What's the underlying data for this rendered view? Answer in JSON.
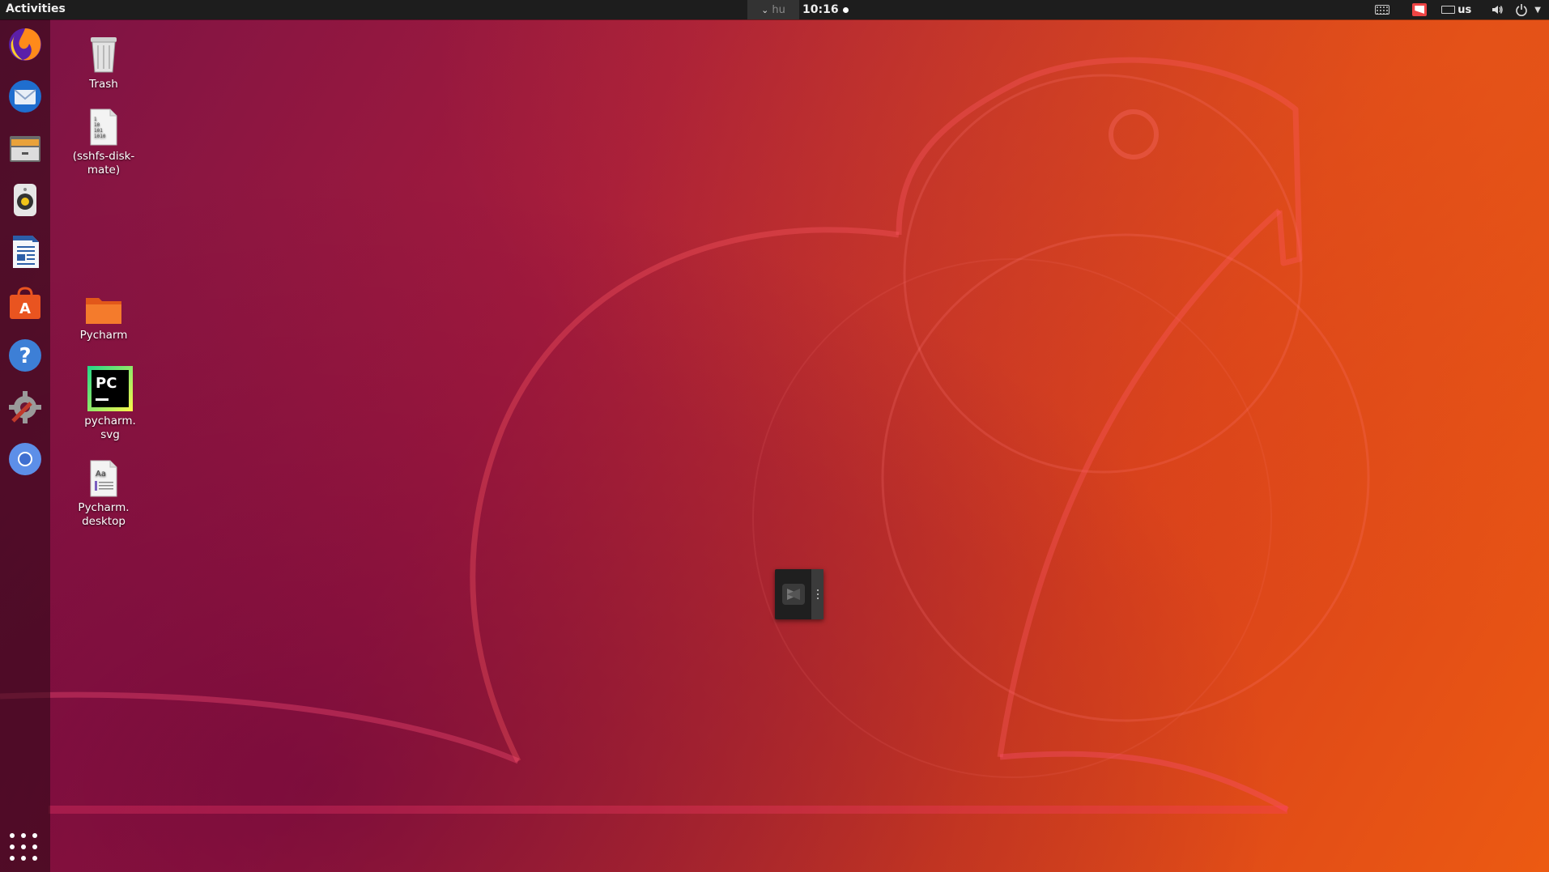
{
  "topbar": {
    "activities_label": "Activities",
    "input_source_label": "hu",
    "clock_text": "10:16",
    "language_label": "us",
    "icons": [
      "chevron-down-icon",
      "keyboard-icon",
      "screenshot-flag-icon",
      "keyboard-layout-icon",
      "volume-icon",
      "power-icon",
      "menu-arrow-icon"
    ]
  },
  "dock": {
    "items": [
      {
        "name": "firefox",
        "icon": "firefox-icon"
      },
      {
        "name": "thunderbird",
        "icon": "thunderbird-icon"
      },
      {
        "name": "files",
        "icon": "files-icon"
      },
      {
        "name": "rhythmbox",
        "icon": "rhythmbox-icon"
      },
      {
        "name": "libreoffice-writer",
        "icon": "writer-icon"
      },
      {
        "name": "software-center",
        "icon": "software-icon"
      },
      {
        "name": "help",
        "icon": "help-icon"
      },
      {
        "name": "settings",
        "icon": "settings-icon"
      },
      {
        "name": "chromium",
        "icon": "chromium-icon"
      }
    ],
    "show_apps_icon": "apps-grid-icon"
  },
  "desktop": {
    "icons": [
      {
        "label": "Trash",
        "icon": "trash-icon"
      },
      {
        "label": "(sshfs-disk-mate)",
        "icon": "binary-file-icon"
      },
      {
        "label": "Pycharm",
        "icon": "folder-icon"
      },
      {
        "label": "pycharm.svg",
        "icon": "pycharm-icon"
      },
      {
        "label": "Pycharm.desktop",
        "icon": "font-file-icon"
      }
    ]
  },
  "colors": {
    "topbar_bg": "#1d1d1d",
    "wall_orange": "#ec5a12",
    "wall_purple": "#7a1245"
  }
}
